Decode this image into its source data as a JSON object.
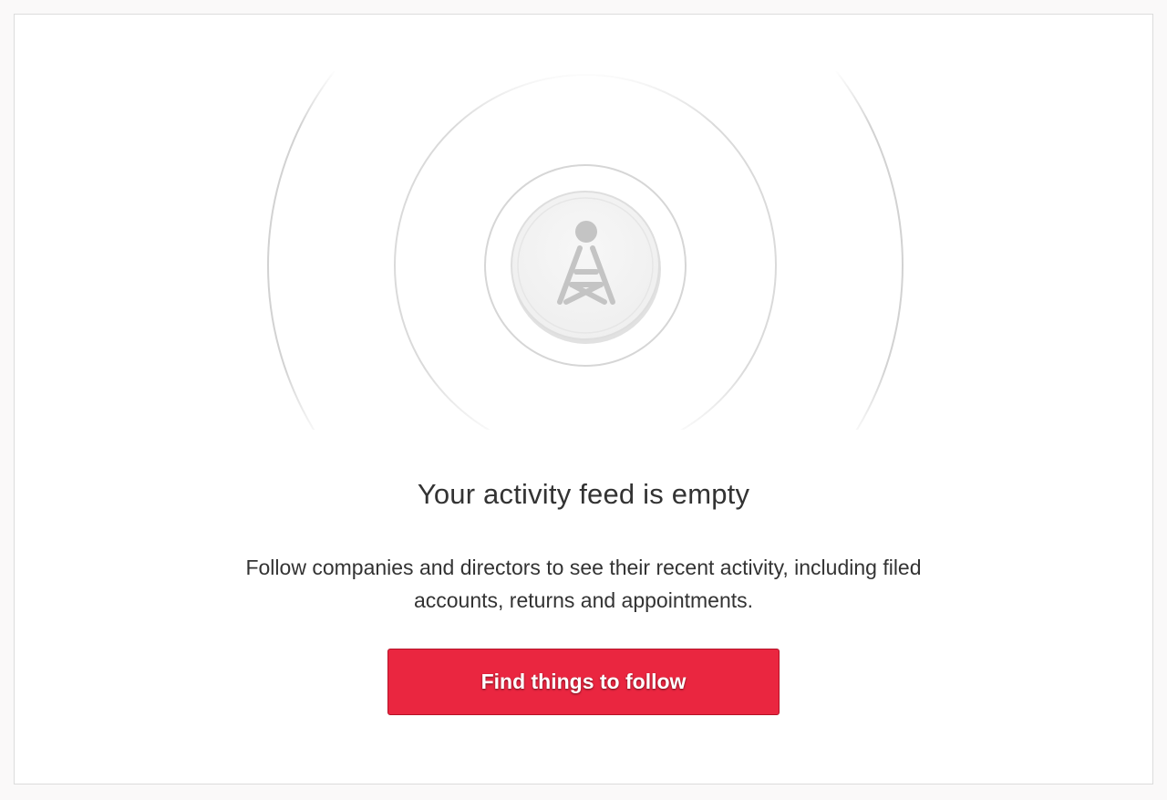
{
  "empty_state": {
    "icon": "broadcast-tower-icon",
    "title": "Your activity feed is empty",
    "description": "Follow companies and directors to see their recent activity, including filed accounts, returns and appointments.",
    "button_label": "Find things to follow"
  },
  "colors": {
    "button_background": "#ea2640",
    "button_border": "#b51227",
    "text": "#333333",
    "icon": "#c4c4c4",
    "page_background": "#faf9f9"
  }
}
